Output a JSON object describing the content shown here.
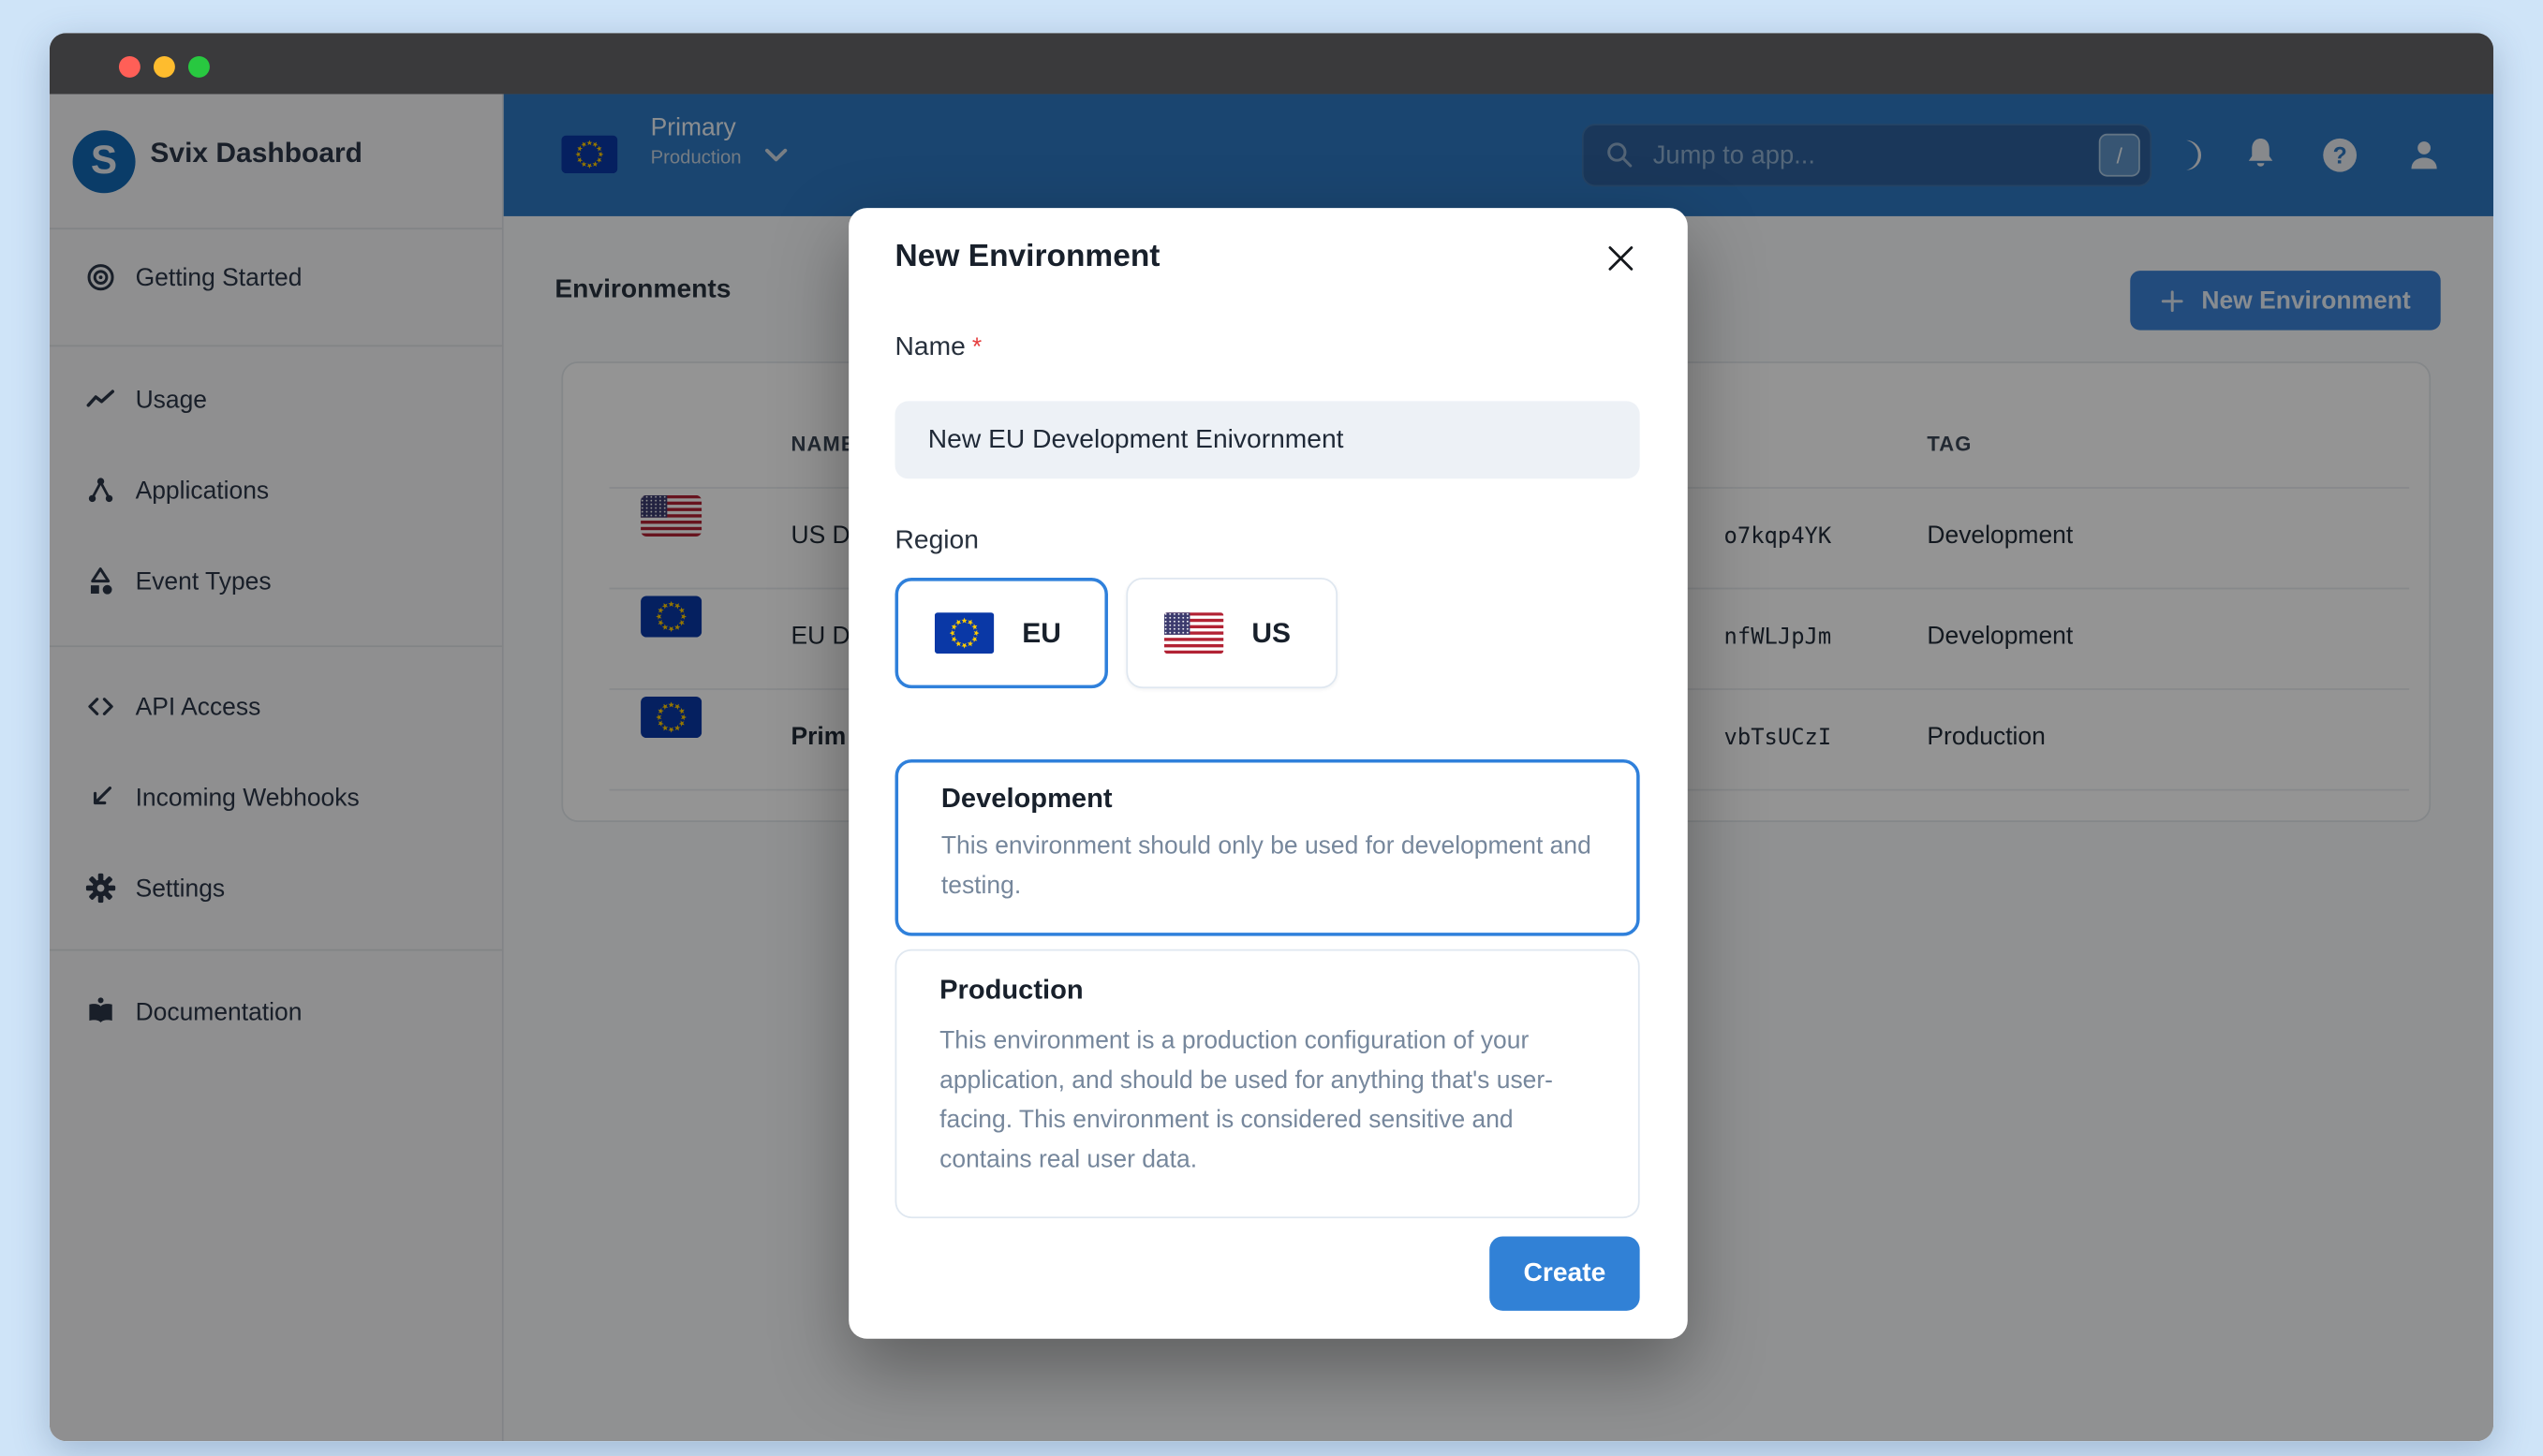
{
  "window": {
    "controls": [
      "close",
      "minimize",
      "zoom"
    ]
  },
  "sidebar": {
    "brand_initial": "S",
    "brand": "Svix Dashboard",
    "items": [
      {
        "icon": "target-icon",
        "label": "Getting Started"
      },
      {
        "icon": "trend-chart-icon",
        "label": "Usage"
      },
      {
        "icon": "share-nodes-icon",
        "label": "Applications"
      },
      {
        "icon": "shapes-icon",
        "label": "Event Types"
      },
      {
        "icon": "code-icon",
        "label": "API Access"
      },
      {
        "icon": "incoming-arrow-icon",
        "label": "Incoming Webhooks"
      },
      {
        "icon": "gear-icon",
        "label": "Settings"
      },
      {
        "icon": "book-reader-icon",
        "label": "Documentation"
      }
    ]
  },
  "header": {
    "environment_switcher": {
      "flag": "eu",
      "name": "Primary",
      "tag": "Production"
    },
    "search": {
      "icon": "magnifier-icon",
      "placeholder": "Jump to app...",
      "shortcut_key": "/"
    },
    "icons": [
      "moon-icon",
      "bell-icon",
      "help-icon",
      "user-icon"
    ]
  },
  "content": {
    "page_title": "Environments",
    "new_environment_button": "New Environment",
    "table": {
      "headers": {
        "name": "NAME",
        "tag": "TAG"
      },
      "rows": [
        {
          "flag": "us",
          "name_visible": "US D",
          "id_visible": "o7kqp4YK",
          "tag": "Development",
          "emphasis": false
        },
        {
          "flag": "eu",
          "name_visible": "EU D",
          "id_visible": "nfWLJpJm",
          "tag": "Development",
          "emphasis": false
        },
        {
          "flag": "eu",
          "name_visible": "Prim",
          "id_visible": "vbTsUCzI",
          "tag": "Production",
          "emphasis": true
        }
      ]
    }
  },
  "modal": {
    "title": "New Environment",
    "close_icon": "x",
    "fields": {
      "name": {
        "label": "Name",
        "required_mark": "*",
        "value": "New EU Development Enivornment"
      },
      "region": {
        "label": "Region",
        "options": [
          {
            "code": "EU",
            "flag": "eu",
            "selected": true
          },
          {
            "code": "US",
            "flag": "us",
            "selected": false
          }
        ]
      }
    },
    "types": [
      {
        "title": "Development",
        "description": "This environment should only be used for development and testing.",
        "selected": true
      },
      {
        "title": "Production",
        "description": "This environment is a production configuration of your application, and should be used for anything that's user-facing. This environment is considered sensitive and contains real user data.",
        "selected": false
      }
    ],
    "create_button": "Create"
  },
  "colors": {
    "accent_blue": "#2f80db",
    "header_blue": "#2e77c2",
    "create_blue": "#3181d6",
    "eu_flag_blue": "#0a38a6",
    "eu_star_yellow": "#ffcc00",
    "us_flag_red": "#b22234",
    "us_flag_canton": "#3c3b6e",
    "overlay": "rgba(0,0,0,0.42)",
    "frame_blue": "#cfe4f8"
  }
}
